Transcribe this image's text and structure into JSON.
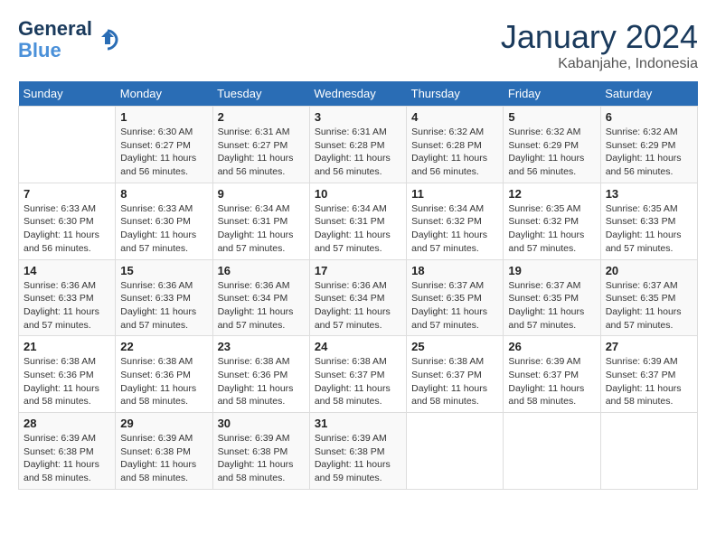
{
  "header": {
    "logo_line1": "General",
    "logo_line2": "Blue",
    "month_title": "January 2024",
    "location": "Kabanjahe, Indonesia"
  },
  "columns": [
    "Sunday",
    "Monday",
    "Tuesday",
    "Wednesday",
    "Thursday",
    "Friday",
    "Saturday"
  ],
  "weeks": [
    [
      {
        "day": "",
        "info": ""
      },
      {
        "day": "1",
        "info": "Sunrise: 6:30 AM\nSunset: 6:27 PM\nDaylight: 11 hours\nand 56 minutes."
      },
      {
        "day": "2",
        "info": "Sunrise: 6:31 AM\nSunset: 6:27 PM\nDaylight: 11 hours\nand 56 minutes."
      },
      {
        "day": "3",
        "info": "Sunrise: 6:31 AM\nSunset: 6:28 PM\nDaylight: 11 hours\nand 56 minutes."
      },
      {
        "day": "4",
        "info": "Sunrise: 6:32 AM\nSunset: 6:28 PM\nDaylight: 11 hours\nand 56 minutes."
      },
      {
        "day": "5",
        "info": "Sunrise: 6:32 AM\nSunset: 6:29 PM\nDaylight: 11 hours\nand 56 minutes."
      },
      {
        "day": "6",
        "info": "Sunrise: 6:32 AM\nSunset: 6:29 PM\nDaylight: 11 hours\nand 56 minutes."
      }
    ],
    [
      {
        "day": "7",
        "info": "Sunrise: 6:33 AM\nSunset: 6:30 PM\nDaylight: 11 hours\nand 56 minutes."
      },
      {
        "day": "8",
        "info": "Sunrise: 6:33 AM\nSunset: 6:30 PM\nDaylight: 11 hours\nand 57 minutes."
      },
      {
        "day": "9",
        "info": "Sunrise: 6:34 AM\nSunset: 6:31 PM\nDaylight: 11 hours\nand 57 minutes."
      },
      {
        "day": "10",
        "info": "Sunrise: 6:34 AM\nSunset: 6:31 PM\nDaylight: 11 hours\nand 57 minutes."
      },
      {
        "day": "11",
        "info": "Sunrise: 6:34 AM\nSunset: 6:32 PM\nDaylight: 11 hours\nand 57 minutes."
      },
      {
        "day": "12",
        "info": "Sunrise: 6:35 AM\nSunset: 6:32 PM\nDaylight: 11 hours\nand 57 minutes."
      },
      {
        "day": "13",
        "info": "Sunrise: 6:35 AM\nSunset: 6:33 PM\nDaylight: 11 hours\nand 57 minutes."
      }
    ],
    [
      {
        "day": "14",
        "info": "Sunrise: 6:36 AM\nSunset: 6:33 PM\nDaylight: 11 hours\nand 57 minutes."
      },
      {
        "day": "15",
        "info": "Sunrise: 6:36 AM\nSunset: 6:33 PM\nDaylight: 11 hours\nand 57 minutes."
      },
      {
        "day": "16",
        "info": "Sunrise: 6:36 AM\nSunset: 6:34 PM\nDaylight: 11 hours\nand 57 minutes."
      },
      {
        "day": "17",
        "info": "Sunrise: 6:36 AM\nSunset: 6:34 PM\nDaylight: 11 hours\nand 57 minutes."
      },
      {
        "day": "18",
        "info": "Sunrise: 6:37 AM\nSunset: 6:35 PM\nDaylight: 11 hours\nand 57 minutes."
      },
      {
        "day": "19",
        "info": "Sunrise: 6:37 AM\nSunset: 6:35 PM\nDaylight: 11 hours\nand 57 minutes."
      },
      {
        "day": "20",
        "info": "Sunrise: 6:37 AM\nSunset: 6:35 PM\nDaylight: 11 hours\nand 57 minutes."
      }
    ],
    [
      {
        "day": "21",
        "info": "Sunrise: 6:38 AM\nSunset: 6:36 PM\nDaylight: 11 hours\nand 58 minutes."
      },
      {
        "day": "22",
        "info": "Sunrise: 6:38 AM\nSunset: 6:36 PM\nDaylight: 11 hours\nand 58 minutes."
      },
      {
        "day": "23",
        "info": "Sunrise: 6:38 AM\nSunset: 6:36 PM\nDaylight: 11 hours\nand 58 minutes."
      },
      {
        "day": "24",
        "info": "Sunrise: 6:38 AM\nSunset: 6:37 PM\nDaylight: 11 hours\nand 58 minutes."
      },
      {
        "day": "25",
        "info": "Sunrise: 6:38 AM\nSunset: 6:37 PM\nDaylight: 11 hours\nand 58 minutes."
      },
      {
        "day": "26",
        "info": "Sunrise: 6:39 AM\nSunset: 6:37 PM\nDaylight: 11 hours\nand 58 minutes."
      },
      {
        "day": "27",
        "info": "Sunrise: 6:39 AM\nSunset: 6:37 PM\nDaylight: 11 hours\nand 58 minutes."
      }
    ],
    [
      {
        "day": "28",
        "info": "Sunrise: 6:39 AM\nSunset: 6:38 PM\nDaylight: 11 hours\nand 58 minutes."
      },
      {
        "day": "29",
        "info": "Sunrise: 6:39 AM\nSunset: 6:38 PM\nDaylight: 11 hours\nand 58 minutes."
      },
      {
        "day": "30",
        "info": "Sunrise: 6:39 AM\nSunset: 6:38 PM\nDaylight: 11 hours\nand 58 minutes."
      },
      {
        "day": "31",
        "info": "Sunrise: 6:39 AM\nSunset: 6:38 PM\nDaylight: 11 hours\nand 59 minutes."
      },
      {
        "day": "",
        "info": ""
      },
      {
        "day": "",
        "info": ""
      },
      {
        "day": "",
        "info": ""
      }
    ]
  ]
}
